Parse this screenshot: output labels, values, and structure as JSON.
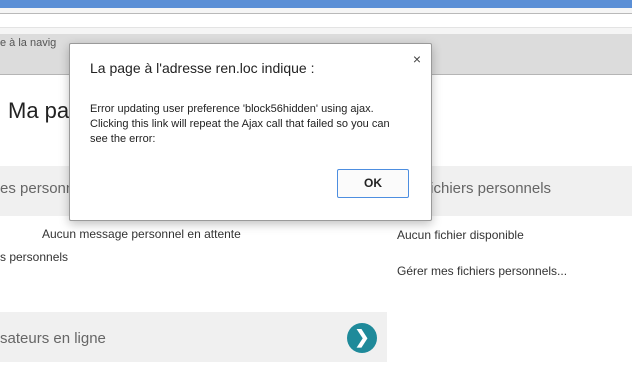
{
  "navbar": {
    "text": "e à la navig"
  },
  "page": {
    "title": "Ma pa"
  },
  "messages_section": {
    "header": "es personn",
    "empty_text": "Aucun message personnel en attente",
    "link": "s personnels"
  },
  "files_section": {
    "header": "fichiers personnels",
    "empty_text": "Aucun fichier disponible",
    "manage_link": "Gérer mes fichiers personnels..."
  },
  "online_section": {
    "header": "sateurs en ligne",
    "arrow": "❯"
  },
  "dialog": {
    "title": "La page à l'adresse ren.loc indique :",
    "close": "×",
    "message": "Error updating user preference 'block56hidden' using ajax. Clicking this link will repeat the Ajax call that failed so you can see the error:",
    "ok_label": "OK"
  }
}
